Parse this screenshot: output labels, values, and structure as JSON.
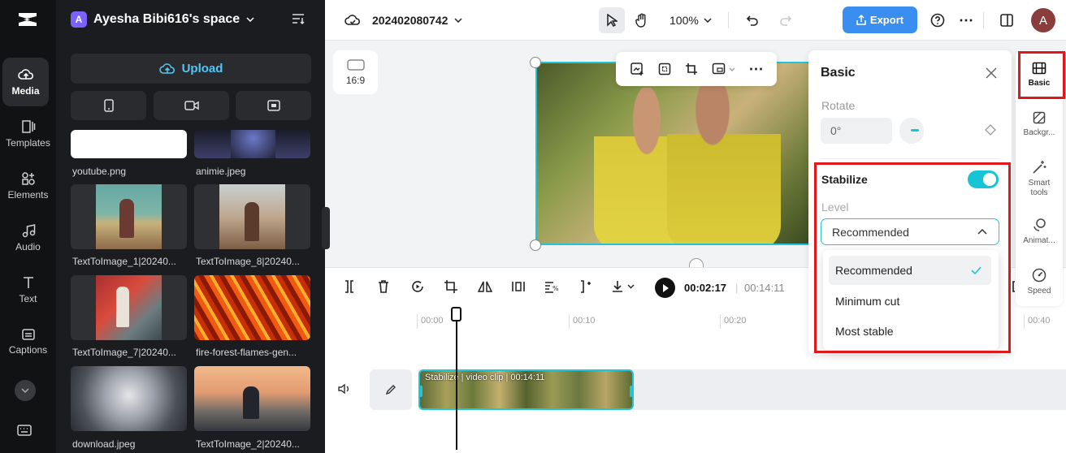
{
  "nav": {
    "items": [
      {
        "label": "Media",
        "icon": "cloud-media-icon"
      },
      {
        "label": "Templates",
        "icon": "templates-icon"
      },
      {
        "label": "Elements",
        "icon": "elements-icon"
      },
      {
        "label": "Audio",
        "icon": "music-note-icon"
      },
      {
        "label": "Text",
        "icon": "text-t-icon"
      },
      {
        "label": "Captions",
        "icon": "captions-icon"
      }
    ]
  },
  "media": {
    "space_initial": "A",
    "space_name": "Ayesha Bibi616's space",
    "upload_label": "Upload",
    "files": [
      {
        "name": "youtube.png"
      },
      {
        "name": "animie.jpeg"
      },
      {
        "name": "TextToImage_1|20240..."
      },
      {
        "name": "TextToImage_8|20240..."
      },
      {
        "name": "TextToImage_7|20240..."
      },
      {
        "name": "fire-forest-flames-gen..."
      },
      {
        "name": "download.jpeg"
      },
      {
        "name": "TextToImage_2|20240..."
      }
    ]
  },
  "topbar": {
    "project_name": "202402080742",
    "zoom": "100%",
    "export_label": "Export",
    "avatar_initial": "A"
  },
  "canvas": {
    "ratio_label": "16:9"
  },
  "timeline": {
    "current_time": "00:02:17",
    "separator": "|",
    "duration": "00:14:11",
    "ticks": [
      "00:00",
      "00:10",
      "00:20",
      "00:40"
    ],
    "clip_label": "Stabilize | video clip | 00:14:11"
  },
  "basic_panel": {
    "title": "Basic",
    "rotate_label": "Rotate",
    "rotate_value": "0°",
    "stabilize_label": "Stabilize",
    "stabilize_on": true,
    "level_label": "Level",
    "level_value": "Recommended",
    "options": [
      "Recommended",
      "Minimum cut",
      "Most stable"
    ],
    "selected_option": "Recommended"
  },
  "rail": {
    "items": [
      {
        "label": "Basic"
      },
      {
        "label": "Backgr..."
      },
      {
        "label": "Smart tools"
      },
      {
        "label": "Animat..."
      },
      {
        "label": "Speed"
      }
    ]
  },
  "colors": {
    "accent": "#20c5d8",
    "export_blue": "#3a8ef0",
    "highlight_red": "#e0171b"
  }
}
